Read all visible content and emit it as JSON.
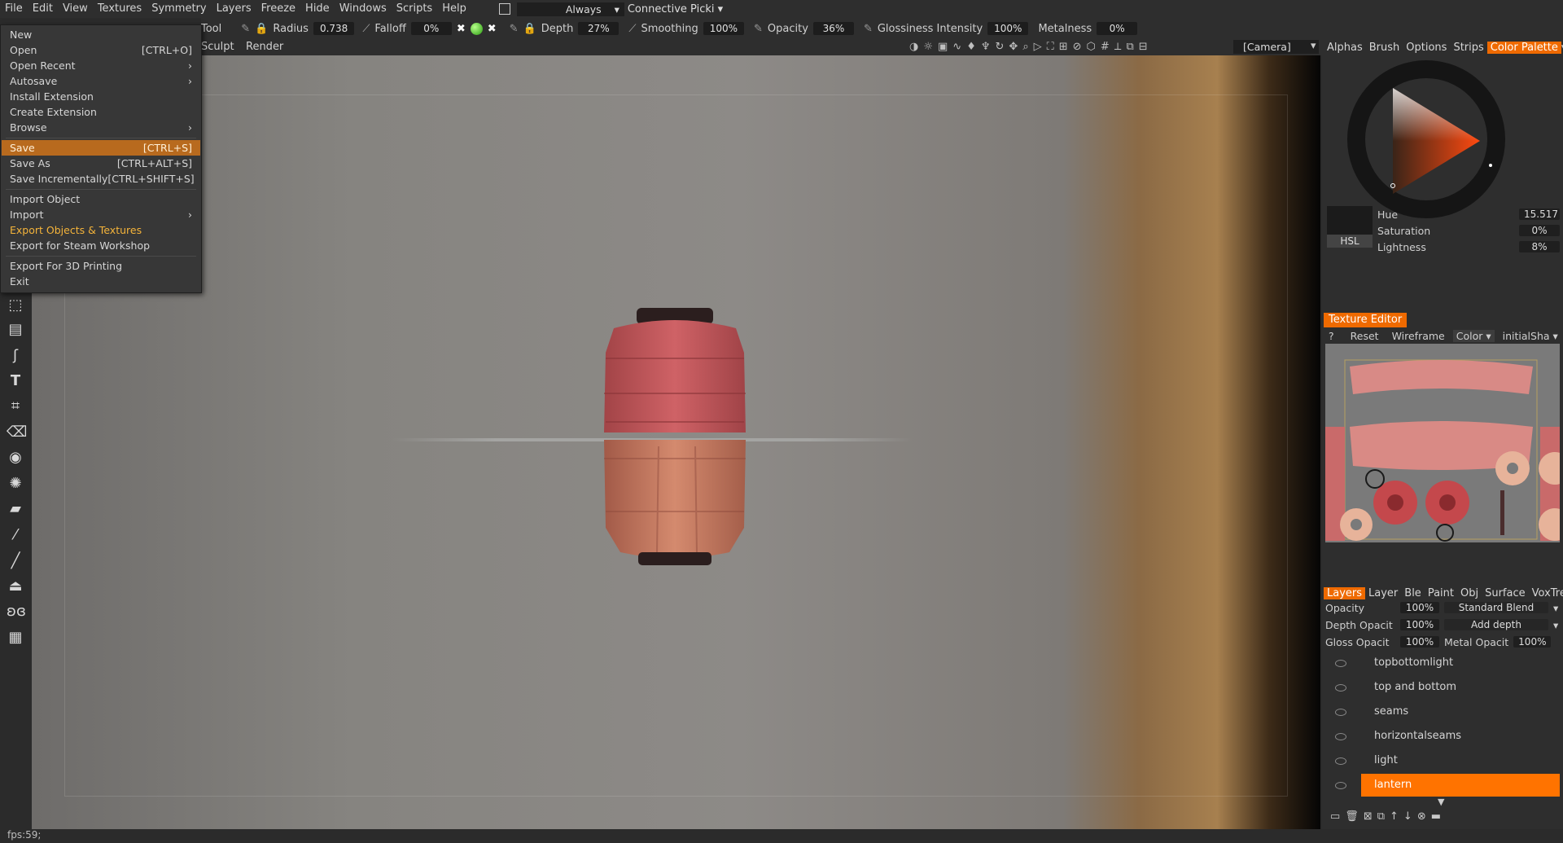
{
  "menubar": {
    "items": [
      "File",
      "Edit",
      "View",
      "Textures",
      "Symmetry",
      "Layers",
      "Freeze",
      "Hide",
      "Windows",
      "Scripts",
      "Help"
    ],
    "always": "Always",
    "connective": "Connective Picki"
  },
  "toolbar": {
    "tool_label": "Tool",
    "radius_label": "Radius",
    "radius_value": "0.738",
    "falloff_label": "Falloff",
    "falloff_value": "0%",
    "depth_label": "Depth",
    "depth_value": "27%",
    "smoothing_label": "Smoothing",
    "smoothing_value": "100%",
    "opacity_label": "Opacity",
    "opacity_value": "36%",
    "glossiness_label": "Glossiness Intensity",
    "glossiness_value": "100%",
    "metalness_label": "Metalness",
    "metalness_value": "0%"
  },
  "room_tabs": {
    "sculpt": "Sculpt",
    "render": "Render",
    "camera": "[Camera]"
  },
  "file_menu": {
    "items": [
      {
        "label": "New",
        "shortcut": ""
      },
      {
        "label": "Open",
        "shortcut": "[CTRL+O]"
      },
      {
        "label": "Open Recent",
        "shortcut": "›"
      },
      {
        "label": "Autosave",
        "shortcut": "›"
      },
      {
        "label": "Install Extension",
        "shortcut": ""
      },
      {
        "label": "Create Extension",
        "shortcut": ""
      },
      {
        "label": "Browse",
        "shortcut": "›"
      },
      {
        "label": "Save",
        "shortcut": "[CTRL+S]"
      },
      {
        "label": "Save As",
        "shortcut": "[CTRL+ALT+S]"
      },
      {
        "label": "Save Incrementally",
        "shortcut": "[CTRL+SHIFT+S]"
      },
      {
        "label": "Import Object",
        "shortcut": ""
      },
      {
        "label": "Import",
        "shortcut": "›"
      },
      {
        "label": "Export Objects & Textures",
        "shortcut": ""
      },
      {
        "label": "Export for Steam Workshop",
        "shortcut": ""
      },
      {
        "label": "Export For 3D Printing",
        "shortcut": ""
      },
      {
        "label": "Exit",
        "shortcut": ""
      }
    ]
  },
  "right_tabs": [
    "Alphas",
    "Brush",
    "Options",
    "Strips",
    "Color Palette"
  ],
  "color": {
    "hue_label": "Hue",
    "hue_value": "15.517",
    "saturation_label": "Saturation",
    "saturation_value": "0%",
    "lightness_label": "Lightness",
    "lightness_value": "8%",
    "mode": "HSL",
    "swatch": "#1b1b1b"
  },
  "texture_editor": {
    "title": "Texture Editor",
    "help": "?",
    "reset": "Reset",
    "wireframe": "Wireframe",
    "channel": "Color",
    "shader": "initialSha"
  },
  "layers_panel": {
    "tabs": [
      "Layers",
      "Layer",
      "Ble",
      "Paint",
      "Obj",
      "Surface",
      "VoxTree"
    ],
    "opacity_label": "Opacity",
    "opacity_value": "100%",
    "blend": "Standard Blend",
    "depth_label": "Depth Opacit",
    "depth_value": "100%",
    "depth_mode": "Add depth",
    "gloss_label": "Gloss Opacit",
    "gloss_value": "100%",
    "metal_label": "Metal Opacit",
    "metal_value": "100%",
    "layers": [
      "topbottomlight",
      "top and bottom",
      "seams",
      "horizontalseams",
      "light",
      "lantern"
    ]
  },
  "status": {
    "fps": "fps:59;"
  },
  "colors": {
    "accent": "#ef6a00",
    "menu_selected": "#b86a1e",
    "highlight_text": "#f5b43a"
  }
}
